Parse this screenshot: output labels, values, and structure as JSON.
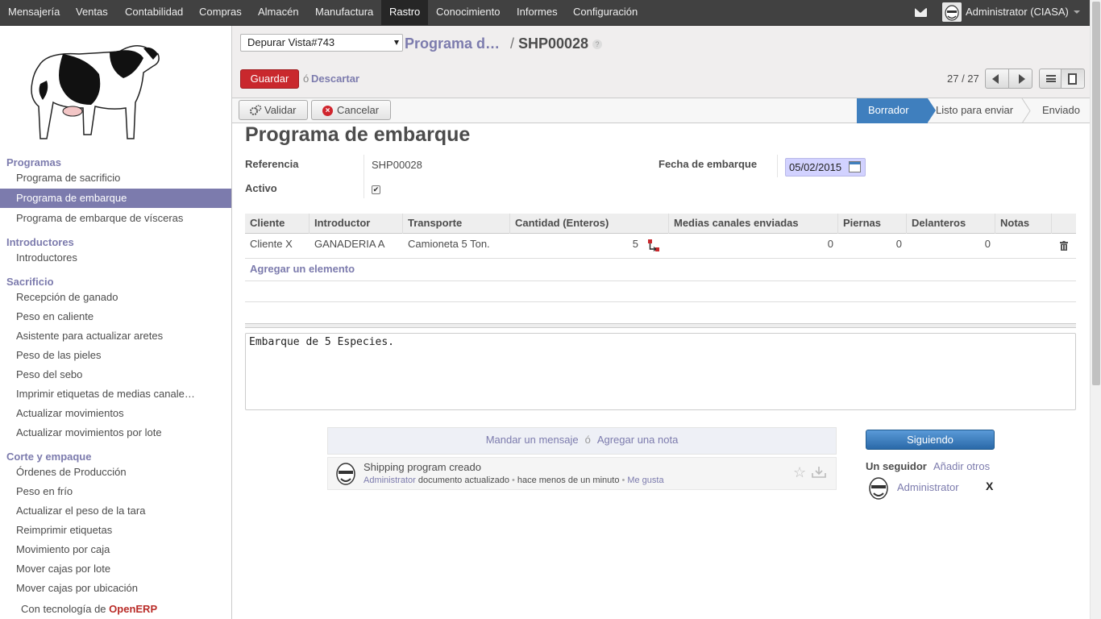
{
  "top_menu": {
    "items": [
      "Mensajería",
      "Ventas",
      "Contabilidad",
      "Compras",
      "Almacén",
      "Manufactura",
      "Rastro",
      "Conocimiento",
      "Informes",
      "Configuración"
    ],
    "active": "Rastro",
    "user": "Administrator (CIASA)"
  },
  "sidebar": {
    "sections": [
      {
        "title": "Programas",
        "items": [
          "Programa de sacrificio",
          "Programa de embarque",
          "Programa de embarque de vísceras"
        ]
      },
      {
        "title": "Introductores",
        "items": [
          "Introductores"
        ]
      },
      {
        "title": "Sacrificio",
        "items": [
          "Recepción de ganado",
          "Peso en caliente",
          "Asistente para actualizar aretes",
          "Peso de las pieles",
          "Peso del sebo",
          "Imprimir etiquetas de medias canale…",
          "Actualizar movimientos",
          "Actualizar movimientos por lote"
        ]
      },
      {
        "title": "Corte y empaque",
        "items": [
          "Órdenes de Producción",
          "Peso en frío",
          "Actualizar el peso de la tara",
          "Reimprimir etiquetas",
          "Movimiento por caja",
          "Mover cajas por lote",
          "Mover cajas por ubicación"
        ]
      }
    ],
    "active_item": "Programa de embarque",
    "powered_prefix": "Con tecnología de",
    "powered_brand": "OpenERP"
  },
  "header": {
    "view_select": "Depurar Vista#743",
    "breadcrumb_parent": "Programa d…",
    "breadcrumb_sep": "/",
    "breadcrumb_current": "SHP00028",
    "help": "?",
    "save_label": "Guardar",
    "or_text": "ó",
    "discard_label": "Descartar",
    "pager": "27 / 27"
  },
  "statusbar": {
    "validate_label": "Validar",
    "cancel_label": "Cancelar",
    "stages": [
      "Borrador",
      "Listo para enviar",
      "Enviado"
    ],
    "active_stage": "Borrador"
  },
  "form": {
    "title": "Programa de embarque",
    "reference_label": "Referencia",
    "reference_value": "SHP00028",
    "active_label": "Activo",
    "active_checked": true,
    "date_label": "Fecha de embarque",
    "date_value": "05/02/2015",
    "table": {
      "headers": [
        "Cliente",
        "Introductor",
        "Transporte",
        "Cantidad (Enteros)",
        "Medias canales enviadas",
        "Piernas",
        "Delanteros",
        "Notas"
      ],
      "rows": [
        {
          "cliente": "Cliente X",
          "introductor": "GANADERIA A",
          "transporte": "Camioneta 5 Ton.",
          "cantidad": "5",
          "medias": "0",
          "piernas": "0",
          "delanteros": "0",
          "notas": ""
        }
      ],
      "add_item": "Agregar un elemento"
    },
    "notes": "Embarque de 5 Especies."
  },
  "chatter": {
    "send_message": "Mandar un mensaje",
    "or_text": "ó",
    "add_note": "Agregar una nota",
    "message": {
      "title": "Shipping program creado",
      "author": "Administrator",
      "action": "documento actualizado",
      "time": "hace menos de un minuto",
      "like": "Me gusta"
    }
  },
  "followers": {
    "following_label": "Siguiendo",
    "count_label": "Un seguidor",
    "add_others": "Añadir otros",
    "follower_name": "Administrator",
    "remove": "X"
  },
  "colors": {
    "accent": "#7c7bad",
    "topbar": "#414141",
    "save": "#c9282d",
    "stage_active": "#3f7fbe"
  }
}
